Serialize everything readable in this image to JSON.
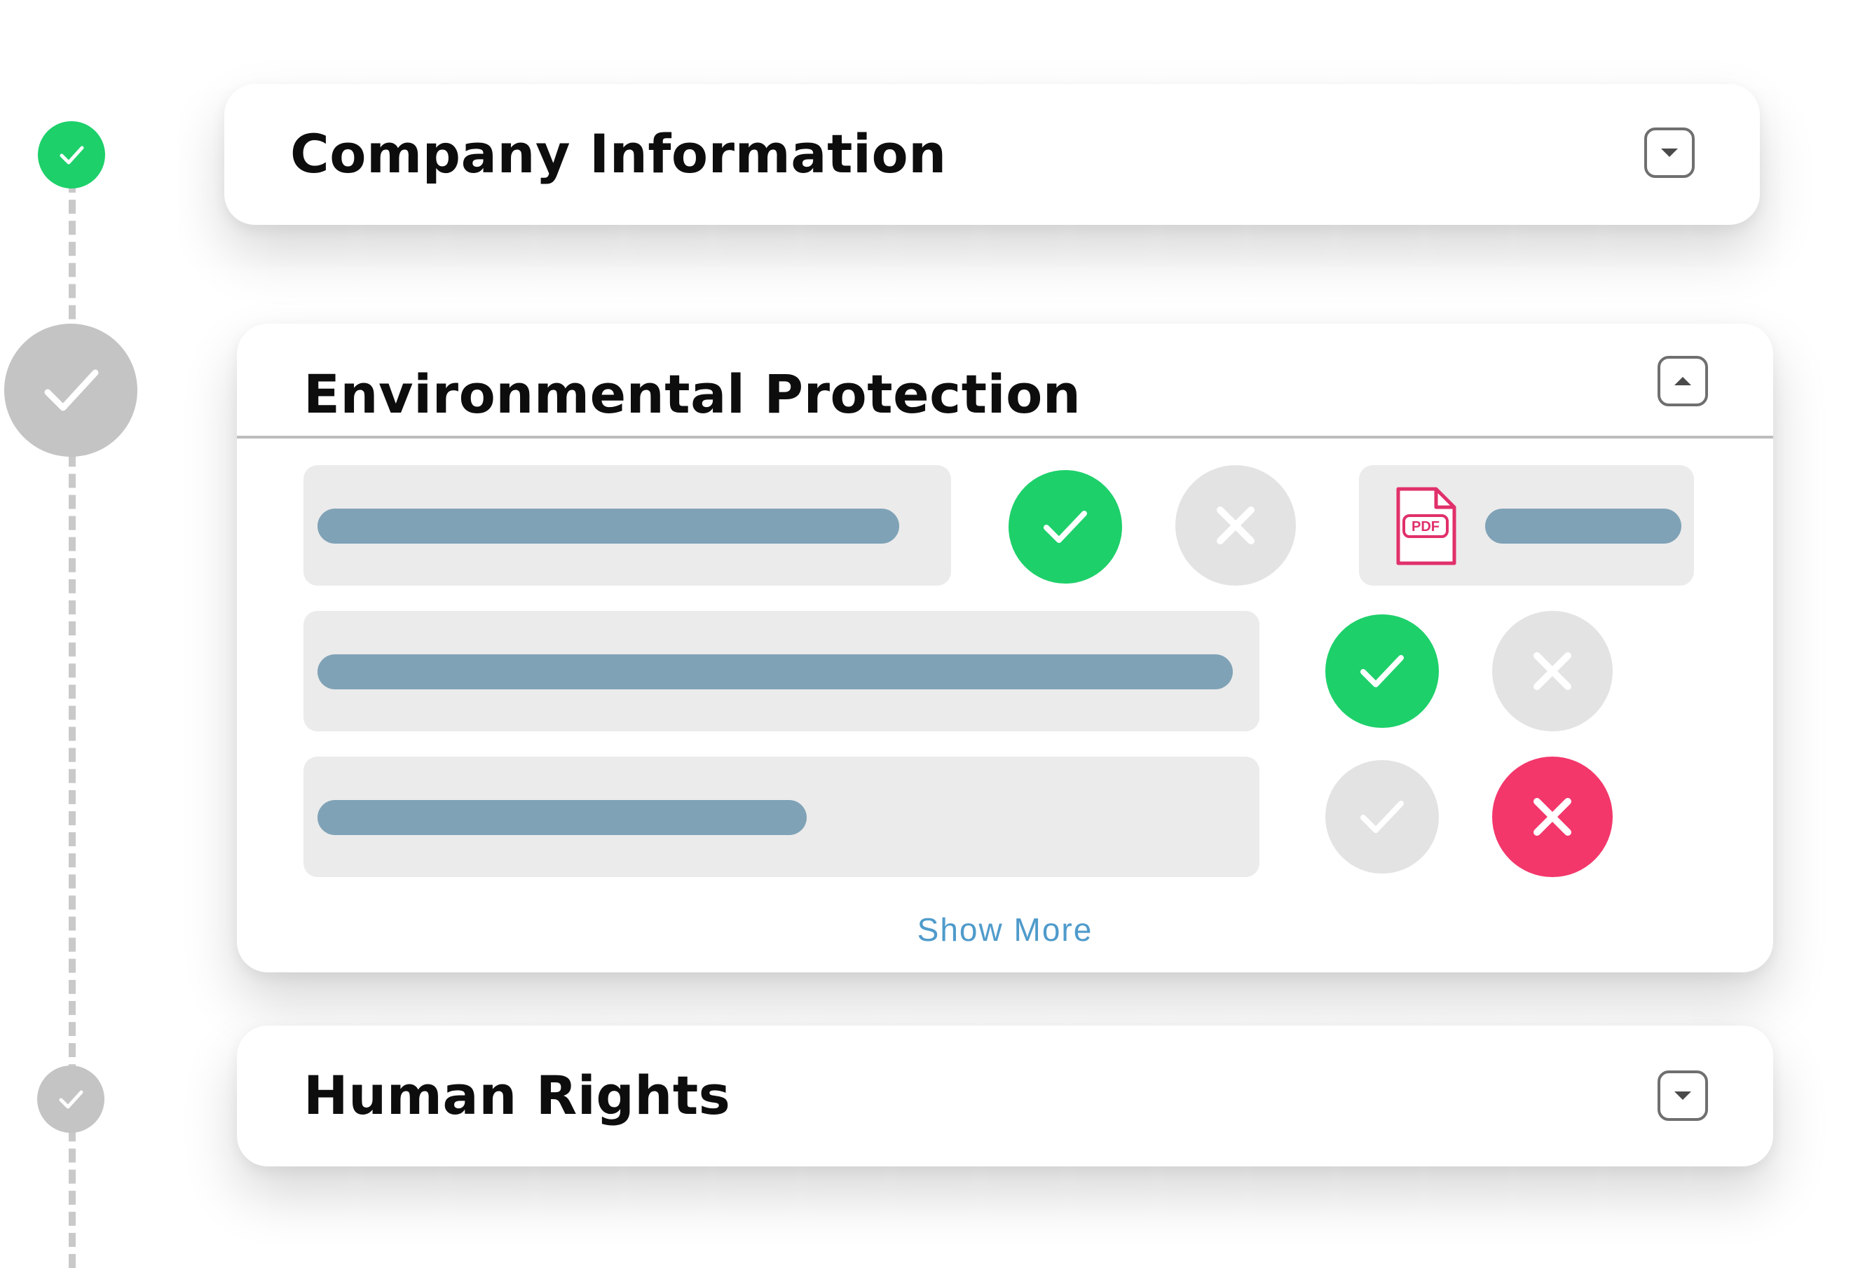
{
  "timeline": {
    "steps": [
      {
        "status": "complete",
        "color": "#1dd06a",
        "icon": "check-icon"
      },
      {
        "status": "current",
        "color": "#c4c4c4",
        "icon": "check-icon"
      },
      {
        "status": "pending",
        "color": "#c4c4c4",
        "icon": "check-icon"
      }
    ]
  },
  "sections": {
    "company": {
      "title": "Company Information",
      "state": "collapsed",
      "toggle_icon": "chevron-down-icon"
    },
    "environmental": {
      "title": "Environmental Protection",
      "state": "expanded",
      "toggle_icon": "chevron-up-icon"
    },
    "human_rights": {
      "title": "Human Rights",
      "state": "collapsed",
      "toggle_icon": "chevron-down-icon"
    }
  },
  "environmental_items": [
    {
      "approve": "selected",
      "reject": "unselected",
      "attachment": {
        "type": "PDF",
        "icon": "pdf-file-icon"
      }
    },
    {
      "approve": "selected",
      "reject": "unselected"
    },
    {
      "approve": "unselected",
      "reject": "selected"
    }
  ],
  "pdf": {
    "label": "PDF"
  },
  "show_more": {
    "label": "Show More"
  },
  "colors": {
    "approve": "#1dd06a",
    "reject": "#f3376b",
    "inactive": "#e3e3e3",
    "placeholder_bar": "#7fa2b6",
    "link": "#4f9bcb"
  }
}
